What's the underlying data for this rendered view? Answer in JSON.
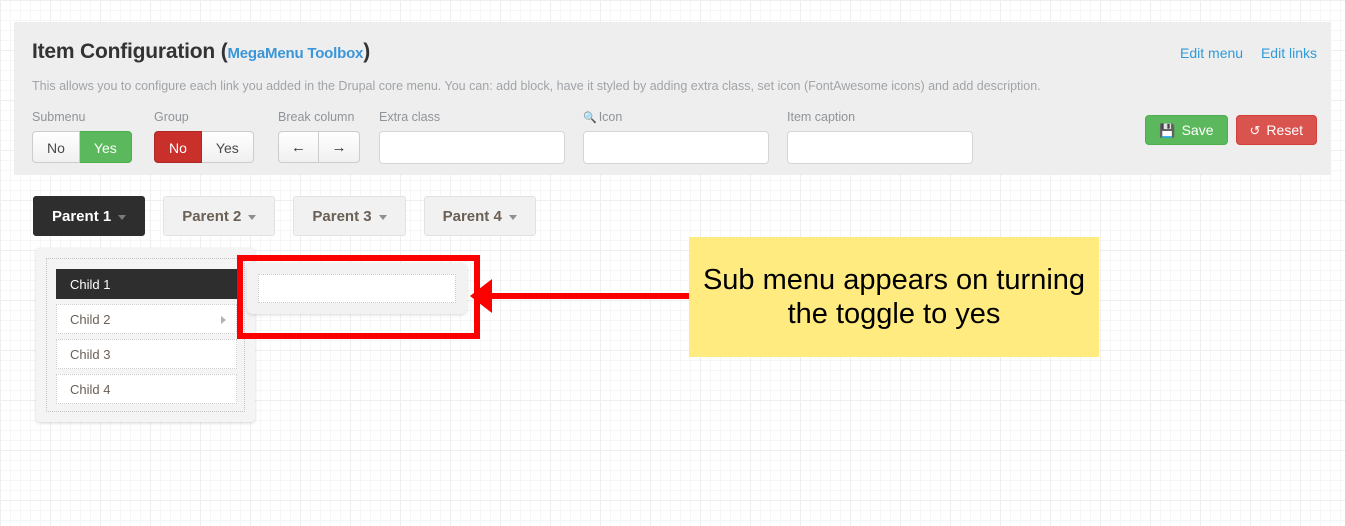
{
  "panel": {
    "title": "Item Configuration",
    "module_link": "MegaMenu Toolbox",
    "paren_open": "(",
    "paren_close": ")",
    "description": "This allows you to configure each link you added in the Drupal core menu. You can: add block, have it styled by adding extra class, set icon (FontAwesome icons) and add description.",
    "header_links": [
      {
        "label": "Edit menu"
      },
      {
        "label": "Edit links"
      }
    ]
  },
  "form": {
    "submenu": {
      "label": "Submenu",
      "options": [
        {
          "label": "No",
          "state": "inactive"
        },
        {
          "label": "Yes",
          "state": "active-green"
        }
      ]
    },
    "group": {
      "label": "Group",
      "options": [
        {
          "label": "No",
          "state": "active-red"
        },
        {
          "label": "Yes",
          "state": "inactive"
        }
      ]
    },
    "break_column": {
      "label": "Break column",
      "buttons": [
        {
          "icon": "arrow-left-icon",
          "glyph": "←"
        },
        {
          "icon": "arrow-right-icon",
          "glyph": "→"
        }
      ]
    },
    "extra_class": {
      "label": "Extra class",
      "value": "",
      "placeholder": ""
    },
    "icon": {
      "label": "Icon",
      "icon_glyph": "🔍",
      "value": "",
      "placeholder": ""
    },
    "item_caption": {
      "label": "Item caption",
      "value": "",
      "placeholder": ""
    }
  },
  "actions": {
    "save": {
      "label": "Save",
      "icon": "floppy-disk-icon",
      "glyph": "💾",
      "color": "#5cb85c"
    },
    "reset": {
      "label": "Reset",
      "icon": "undo-icon",
      "glyph": "↺",
      "color": "#d9534f"
    }
  },
  "menu": {
    "parents": [
      {
        "label": "Parent 1",
        "active": true
      },
      {
        "label": "Parent 2",
        "active": false
      },
      {
        "label": "Parent 3",
        "active": false
      },
      {
        "label": "Parent 4",
        "active": false
      }
    ],
    "children": [
      {
        "label": "Child 1",
        "active": true,
        "has_submenu": false
      },
      {
        "label": "Child 2",
        "active": false,
        "has_submenu": true
      },
      {
        "label": "Child 3",
        "active": false,
        "has_submenu": false
      },
      {
        "label": "Child 4",
        "active": false,
        "has_submenu": false
      }
    ]
  },
  "annotation": {
    "callout_text": "Sub menu appears on turning the toggle to yes",
    "highlight_color": "#fc0000",
    "callout_bg": "#ffeb7f"
  }
}
